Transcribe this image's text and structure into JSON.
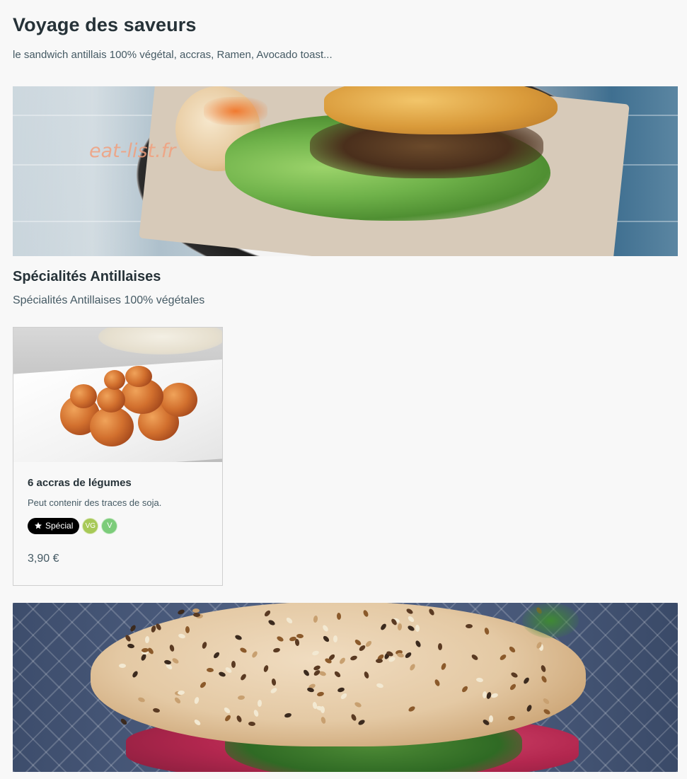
{
  "menu": {
    "title": "Voyage des saveurs",
    "subtitle": "le sandwich antillais 100% végétal, accras, Ramen, Avocado toast..."
  },
  "watermark": "eat-list.fr",
  "section": {
    "title": "Spécialités Antillaises",
    "description": "Spécialités Antillaises 100% végétales"
  },
  "product": {
    "name": "6 accras de légumes",
    "description": "Peut contenir des traces de soja.",
    "special_label": "Spécial",
    "special_icon": "star-icon",
    "diet_badges": [
      {
        "label": "VG",
        "color": "#a7c957"
      },
      {
        "label": "V",
        "color": "#7ccc7a"
      }
    ],
    "price": "3,90 €"
  },
  "colors": {
    "background": "#f8f8f8",
    "text_primary": "#263238",
    "text_secondary": "#455a64",
    "special_badge_bg": "#000000",
    "watermark": "#f1a07e"
  }
}
